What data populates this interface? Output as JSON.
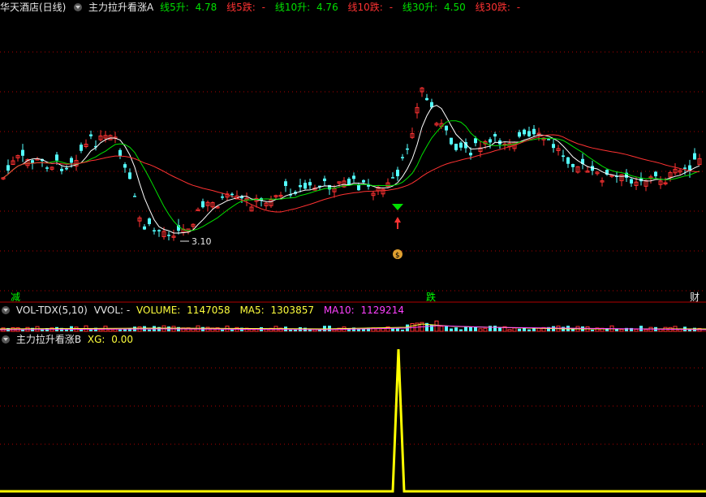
{
  "title": "华天酒店(日线)",
  "indicator_a": {
    "name": "主力拉升看涨A",
    "items": [
      {
        "label": "线5升:",
        "value": "4.78",
        "color": "green"
      },
      {
        "label": "线5跌:",
        "value": "-",
        "color": "red"
      },
      {
        "label": "线10升:",
        "value": "4.76",
        "color": "green"
      },
      {
        "label": "线10跌:",
        "value": "-",
        "color": "red"
      },
      {
        "label": "线30升:",
        "value": "4.50",
        "color": "green"
      },
      {
        "label": "线30跌:",
        "value": "-",
        "color": "red"
      }
    ]
  },
  "low_label": "3.10",
  "bottom_tags": [
    "减",
    "跌",
    "财"
  ],
  "volume": {
    "name": "VOL-TDX(5,10)",
    "vvol": "VVOL: -",
    "volume_label": "VOLUME:",
    "volume_value": "1147058",
    "ma5_label": "MA5:",
    "ma5_value": "1303857",
    "ma10_label": "MA10:",
    "ma10_value": "1129214"
  },
  "indicator_b": {
    "name": "主力拉升看涨B",
    "xg_label": "XG:",
    "xg_value": "0.00"
  },
  "colors": {
    "up": "#ff3232",
    "down": "#54ffff",
    "ma5": "#ffffff",
    "ma10": "#00e000",
    "ma30": "#ff3232",
    "xg": "#ffff00",
    "grid": "#b00000"
  }
}
